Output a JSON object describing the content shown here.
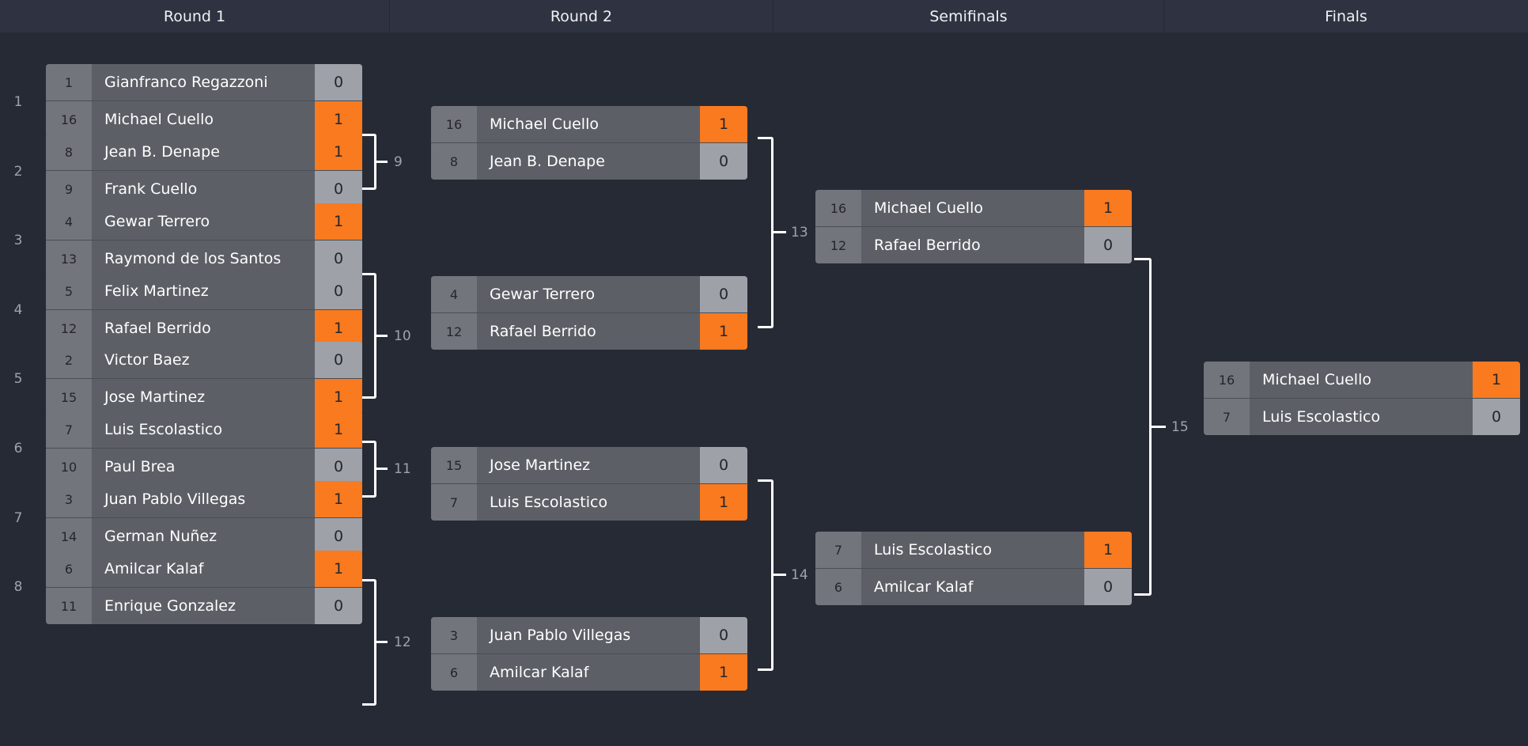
{
  "header": {
    "rounds": [
      {
        "label": "Round 1"
      },
      {
        "label": "Round 2"
      },
      {
        "label": "Semifinals"
      },
      {
        "label": "Finals"
      }
    ]
  },
  "row_indices": [
    "1",
    "2",
    "3",
    "4",
    "5",
    "6",
    "7",
    "8"
  ],
  "rounds": {
    "round1": {
      "matches": [
        {
          "top": {
            "seed": "1",
            "name": "Gianfranco Regazzoni",
            "score": "0",
            "winner": false
          },
          "bottom": {
            "seed": "16",
            "name": "Michael Cuello",
            "score": "1",
            "winner": true
          }
        },
        {
          "top": {
            "seed": "8",
            "name": "Jean B. Denape",
            "score": "1",
            "winner": true
          },
          "bottom": {
            "seed": "9",
            "name": "Frank Cuello",
            "score": "0",
            "winner": false
          }
        },
        {
          "top": {
            "seed": "4",
            "name": "Gewar Terrero",
            "score": "1",
            "winner": true
          },
          "bottom": {
            "seed": "13",
            "name": "Raymond de los Santos",
            "score": "0",
            "winner": false
          }
        },
        {
          "top": {
            "seed": "5",
            "name": "Felix Martinez",
            "score": "0",
            "winner": false
          },
          "bottom": {
            "seed": "12",
            "name": "Rafael Berrido",
            "score": "1",
            "winner": true
          }
        },
        {
          "top": {
            "seed": "2",
            "name": "Victor Baez",
            "score": "0",
            "winner": false
          },
          "bottom": {
            "seed": "15",
            "name": "Jose Martinez",
            "score": "1",
            "winner": true
          }
        },
        {
          "top": {
            "seed": "7",
            "name": "Luis Escolastico",
            "score": "1",
            "winner": true
          },
          "bottom": {
            "seed": "10",
            "name": "Paul Brea",
            "score": "0",
            "winner": false
          }
        },
        {
          "top": {
            "seed": "3",
            "name": "Juan Pablo Villegas",
            "score": "1",
            "winner": true
          },
          "bottom": {
            "seed": "14",
            "name": "German Nuñez",
            "score": "0",
            "winner": false
          }
        },
        {
          "top": {
            "seed": "6",
            "name": "Amilcar Kalaf",
            "score": "1",
            "winner": true
          },
          "bottom": {
            "seed": "11",
            "name": "Enrique Gonzalez",
            "score": "0",
            "winner": false
          }
        }
      ]
    },
    "round2": {
      "matches": [
        {
          "top": {
            "seed": "16",
            "name": "Michael Cuello",
            "score": "1",
            "winner": true
          },
          "bottom": {
            "seed": "8",
            "name": "Jean B. Denape",
            "score": "0",
            "winner": false
          }
        },
        {
          "top": {
            "seed": "4",
            "name": "Gewar Terrero",
            "score": "0",
            "winner": false
          },
          "bottom": {
            "seed": "12",
            "name": "Rafael Berrido",
            "score": "1",
            "winner": true
          }
        },
        {
          "top": {
            "seed": "15",
            "name": "Jose Martinez",
            "score": "0",
            "winner": false
          },
          "bottom": {
            "seed": "7",
            "name": "Luis Escolastico",
            "score": "1",
            "winner": true
          }
        },
        {
          "top": {
            "seed": "3",
            "name": "Juan Pablo Villegas",
            "score": "0",
            "winner": false
          },
          "bottom": {
            "seed": "6",
            "name": "Amilcar Kalaf",
            "score": "1",
            "winner": true
          }
        }
      ]
    },
    "semifinals": {
      "matches": [
        {
          "top": {
            "seed": "16",
            "name": "Michael Cuello",
            "score": "1",
            "winner": true
          },
          "bottom": {
            "seed": "12",
            "name": "Rafael Berrido",
            "score": "0",
            "winner": false
          }
        },
        {
          "top": {
            "seed": "7",
            "name": "Luis Escolastico",
            "score": "1",
            "winner": true
          },
          "bottom": {
            "seed": "6",
            "name": "Amilcar Kalaf",
            "score": "0",
            "winner": false
          }
        }
      ]
    },
    "finals": {
      "matches": [
        {
          "top": {
            "seed": "16",
            "name": "Michael Cuello",
            "score": "1",
            "winner": true
          },
          "bottom": {
            "seed": "7",
            "name": "Luis Escolastico",
            "score": "0",
            "winner": false
          }
        }
      ]
    }
  },
  "connector_labels": {
    "r1_to_r2": [
      "9",
      "10",
      "11",
      "12"
    ],
    "r2_to_sf": [
      "13",
      "14"
    ],
    "sf_to_final": [
      "15"
    ]
  }
}
